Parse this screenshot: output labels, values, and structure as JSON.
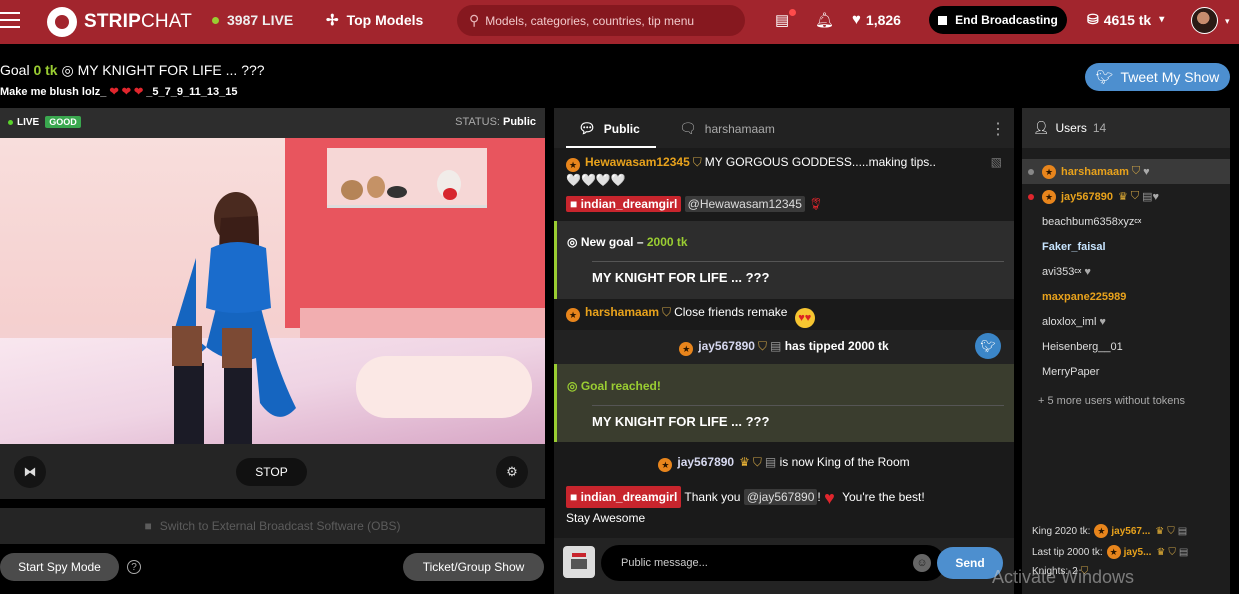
{
  "header": {
    "brand_bold": "STRIP",
    "brand_thin": "CHAT",
    "live_count": "3987 LIVE",
    "top_models": "Top Models",
    "search_placeholder": "Models, categories, countries, tip menu",
    "hearts": "1,826",
    "end_broadcasting": "End Broadcasting",
    "tokens": "4615 tk"
  },
  "goal": {
    "prefix": "Goal",
    "amount": "0 tk",
    "title": "MY KNIGHT FOR LIFE ... ???",
    "subtitle_start": "Make me blush lolz_",
    "subtitle_end": "_5_7_9_11_13_15"
  },
  "tweet_button": "Tweet My Show",
  "video": {
    "live_label": "LIVE",
    "quality": "GOOD",
    "status_label": "STATUS:",
    "status_value": "Public",
    "stop": "STOP",
    "obs": "Switch to External Broadcast Software (OBS)",
    "spy_mode": "Start Spy Mode",
    "help": "?",
    "ticket_show": "Ticket/Group Show"
  },
  "chat": {
    "tab_public": "Public",
    "tab_private": "harshamaam",
    "messages": {
      "m1_user": "Hewawasam12345",
      "m1_text": "MY GORGOUS GODDESS.....making tips..",
      "m1_hearts": "🤍🤍🤍🤍",
      "m2_user": "indian_dreamgirl",
      "m2_mention": "@Hewawasam12345",
      "new_goal_label": "New goal –",
      "new_goal_amount": "2000 tk",
      "new_goal_title": "MY KNIGHT FOR LIFE ... ???",
      "m3_user": "harshamaam",
      "m3_text": "Close friends remake",
      "tip_user": "jay567890",
      "tip_text": "has tipped 2000 tk",
      "goal_reached": "Goal reached!",
      "goal_reached_title": "MY KNIGHT FOR LIFE ... ???",
      "king_user": "jay567890",
      "king_text": "is now King of the Room",
      "m4_user": "indian_dreamgirl",
      "m4_text_a": "Thank you",
      "m4_mention": "@jay567890",
      "m4_text_b": "!",
      "m4_text_c": "You're the best!",
      "m4_text_d": "Stay Awesome"
    },
    "input_placeholder": "Public message...",
    "send": "Send"
  },
  "users": {
    "title": "Users",
    "count": "14",
    "list": [
      {
        "name": "harshamaam"
      },
      {
        "name": "jay567890"
      },
      {
        "name": "beachbum6358xyz"
      },
      {
        "name": "Faker_faisal"
      },
      {
        "name": "avi353"
      },
      {
        "name": "maxpane225989"
      },
      {
        "name": "aloxlox_iml"
      },
      {
        "name": "Heisenberg__01"
      },
      {
        "name": "MerryPaper"
      }
    ],
    "sup_cx": "cx",
    "more": "+ 5 more users without tokens",
    "king_label": "King 2020 tk:",
    "king_user": "jay567...",
    "last_tip_label": "Last tip 2000 tk:",
    "last_tip_user": "jay5...",
    "knights_label": "Knights:",
    "knights_count": "2"
  },
  "watermark": "Activate Windows",
  "colors": {
    "topbar": "#a2252d",
    "accent_green": "#9acd32",
    "accent_blue": "#4d8fcf",
    "username_orange": "#e8a21c"
  }
}
